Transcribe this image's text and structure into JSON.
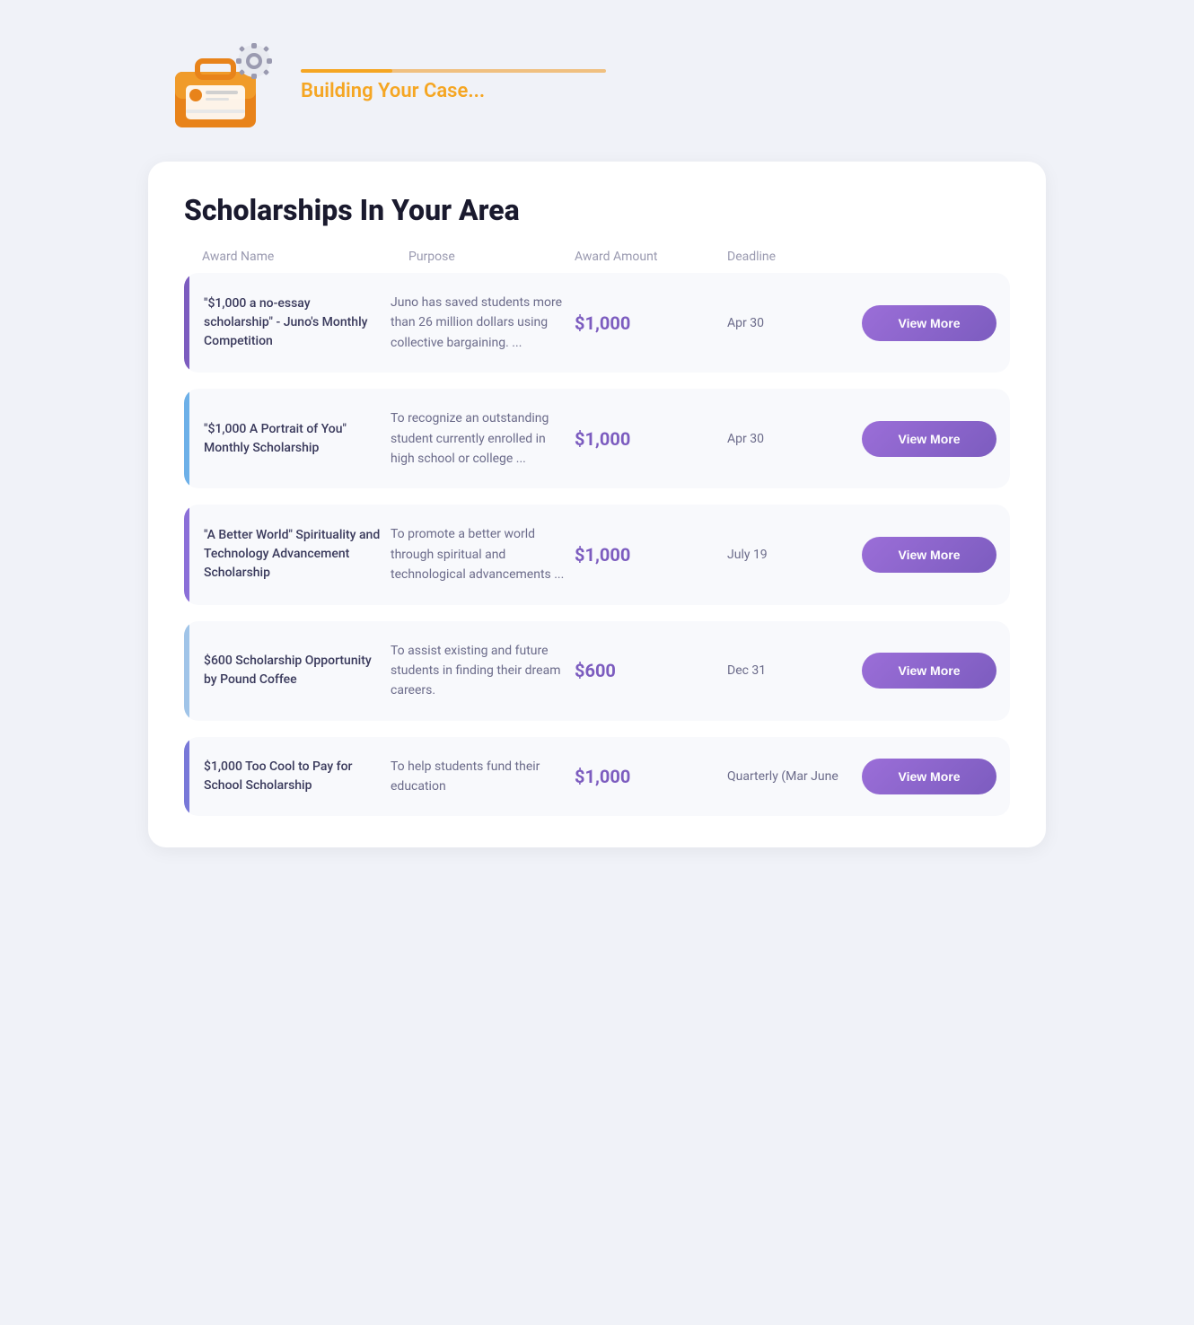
{
  "header": {
    "progress_bar_percent": 30,
    "building_text": "Building Your Case...",
    "icon_alt": "briefcase with gear icon"
  },
  "main": {
    "section_title": "Scholarships In Your Area",
    "table_headers": {
      "award_name": "Award Name",
      "purpose": "Purpose",
      "award_amount": "Award Amount",
      "deadline": "Deadline",
      "action": ""
    },
    "scholarships": [
      {
        "id": 1,
        "accent": "purple",
        "name": "\"$1,000 a no-essay scholarship\" - Juno's Monthly Competition",
        "purpose": "Juno has saved students more than 26 million dollars using collective bargaining. ...",
        "amount": "$1,000",
        "deadline": "Apr 30",
        "button_label": "View More"
      },
      {
        "id": 2,
        "accent": "blue",
        "name": "\"$1,000 A Portrait of You\" Monthly Scholarship",
        "purpose": "To recognize an outstanding student currently enrolled in high school or college ...",
        "amount": "$1,000",
        "deadline": "Apr 30",
        "button_label": "View More"
      },
      {
        "id": 3,
        "accent": "violet",
        "name": "\"A Better World\" Spirituality and Technology Advancement Scholarship",
        "purpose": "To promote a better world through spiritual and technological advancements ...",
        "amount": "$1,000",
        "deadline": "July 19",
        "button_label": "View More"
      },
      {
        "id": 4,
        "accent": "lightblue",
        "name": "$600 Scholarship Opportunity by Pound Coffee",
        "purpose": "To assist existing and future students in finding their dream careers.",
        "amount": "$600",
        "deadline": "Dec 31",
        "button_label": "View More"
      },
      {
        "id": 5,
        "accent": "indigo",
        "name": "$1,000 Too Cool to Pay for School Scholarship",
        "purpose": "To help students fund their education",
        "amount": "$1,000",
        "deadline": "Quarterly (Mar June",
        "button_label": "View More"
      }
    ]
  }
}
